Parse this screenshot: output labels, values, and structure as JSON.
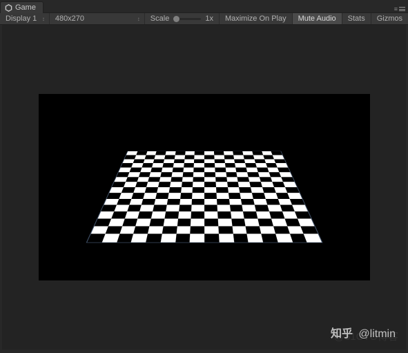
{
  "tab": {
    "label": "Game"
  },
  "toolbar": {
    "display_label": "Display 1",
    "resolution": "480x270",
    "scale_label": "Scale",
    "scale_value": "1x",
    "maximize": "Maximize On Play",
    "mute": "Mute Audio",
    "stats": "Stats",
    "gizmos": "Gizmos"
  },
  "watermark": {
    "brand": "知乎",
    "handle": "@litmin",
    "shadow": "@51CTO博客"
  },
  "colors": {
    "panel_bg": "#393939",
    "app_bg": "#282828",
    "viewport_bg": "#232323",
    "text": "#b4b4b4"
  }
}
